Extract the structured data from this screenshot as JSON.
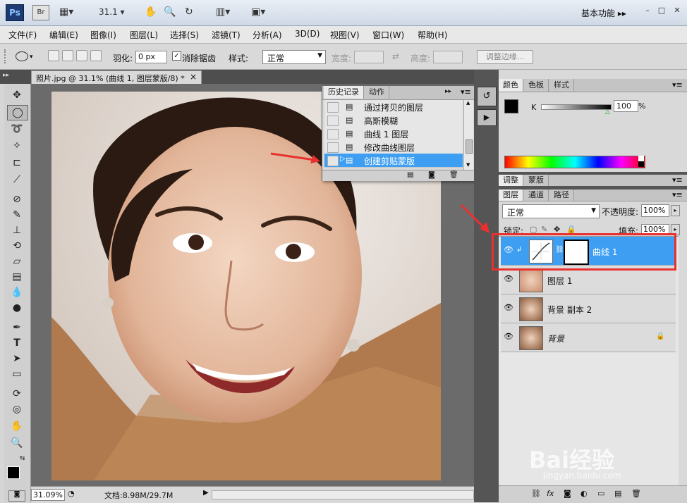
{
  "titlebar": {
    "ps_logo": "Ps",
    "br_logo": "Br",
    "zoom_value": "31.1",
    "workspace": "基本功能",
    "minimize": "–",
    "restore": "□",
    "close": "✕"
  },
  "menubar": {
    "items": [
      "文件(F)",
      "编辑(E)",
      "图像(I)",
      "图层(L)",
      "选择(S)",
      "滤镜(T)",
      "分析(A)",
      "3D(D)",
      "视图(V)",
      "窗口(W)",
      "帮助(H)"
    ]
  },
  "options": {
    "feather_label": "羽化:",
    "feather_value": "0 px",
    "antialias_label": "消除锯齿",
    "antialias_checked": true,
    "style_label": "样式:",
    "style_value": "正常",
    "width_label": "宽度:",
    "height_label": "高度:",
    "refine_edge": "调整边缘..."
  },
  "document": {
    "tab_title": "照片.jpg @ 31.1% (曲线 1, 图层蒙版/8) *",
    "tab_close": "×"
  },
  "statusbar": {
    "zoom": "31.09%",
    "doc_info": "文档:8.98M/29.7M"
  },
  "history_panel": {
    "tabs": [
      "历史记录",
      "动作"
    ],
    "rows": [
      {
        "label": "通过拷贝的图层",
        "selected": false
      },
      {
        "label": "高斯模糊",
        "selected": false
      },
      {
        "label": "曲线 1 图层",
        "selected": false
      },
      {
        "label": "修改曲线图层",
        "selected": false
      },
      {
        "label": "创建剪贴蒙版",
        "selected": true
      }
    ]
  },
  "color_panel": {
    "tabs": [
      "颜色",
      "色板",
      "样式"
    ],
    "channel_label": "K",
    "channel_value": "100",
    "percent": "%"
  },
  "adjust_panel": {
    "tabs": [
      "调整",
      "蒙版"
    ]
  },
  "layers_panel": {
    "tabs": [
      "图层",
      "通道",
      "路径"
    ],
    "blend_mode": "正常",
    "opacity_label": "不透明度:",
    "opacity_value": "100%",
    "lock_label": "锁定:",
    "fill_label": "填充:",
    "fill_value": "100%",
    "layers": [
      {
        "name": "曲线 1",
        "selected": true
      },
      {
        "name": "图层 1",
        "selected": false
      },
      {
        "name": "背景 副本 2",
        "selected": false
      },
      {
        "name": "背景",
        "selected": false,
        "locked": true
      }
    ]
  },
  "watermark": {
    "brand": "Bai经验",
    "url": "jingyan.baidu.com"
  },
  "colors": {
    "selection_blue": "#3d9ef2",
    "highlight_red": "#e8312f"
  }
}
